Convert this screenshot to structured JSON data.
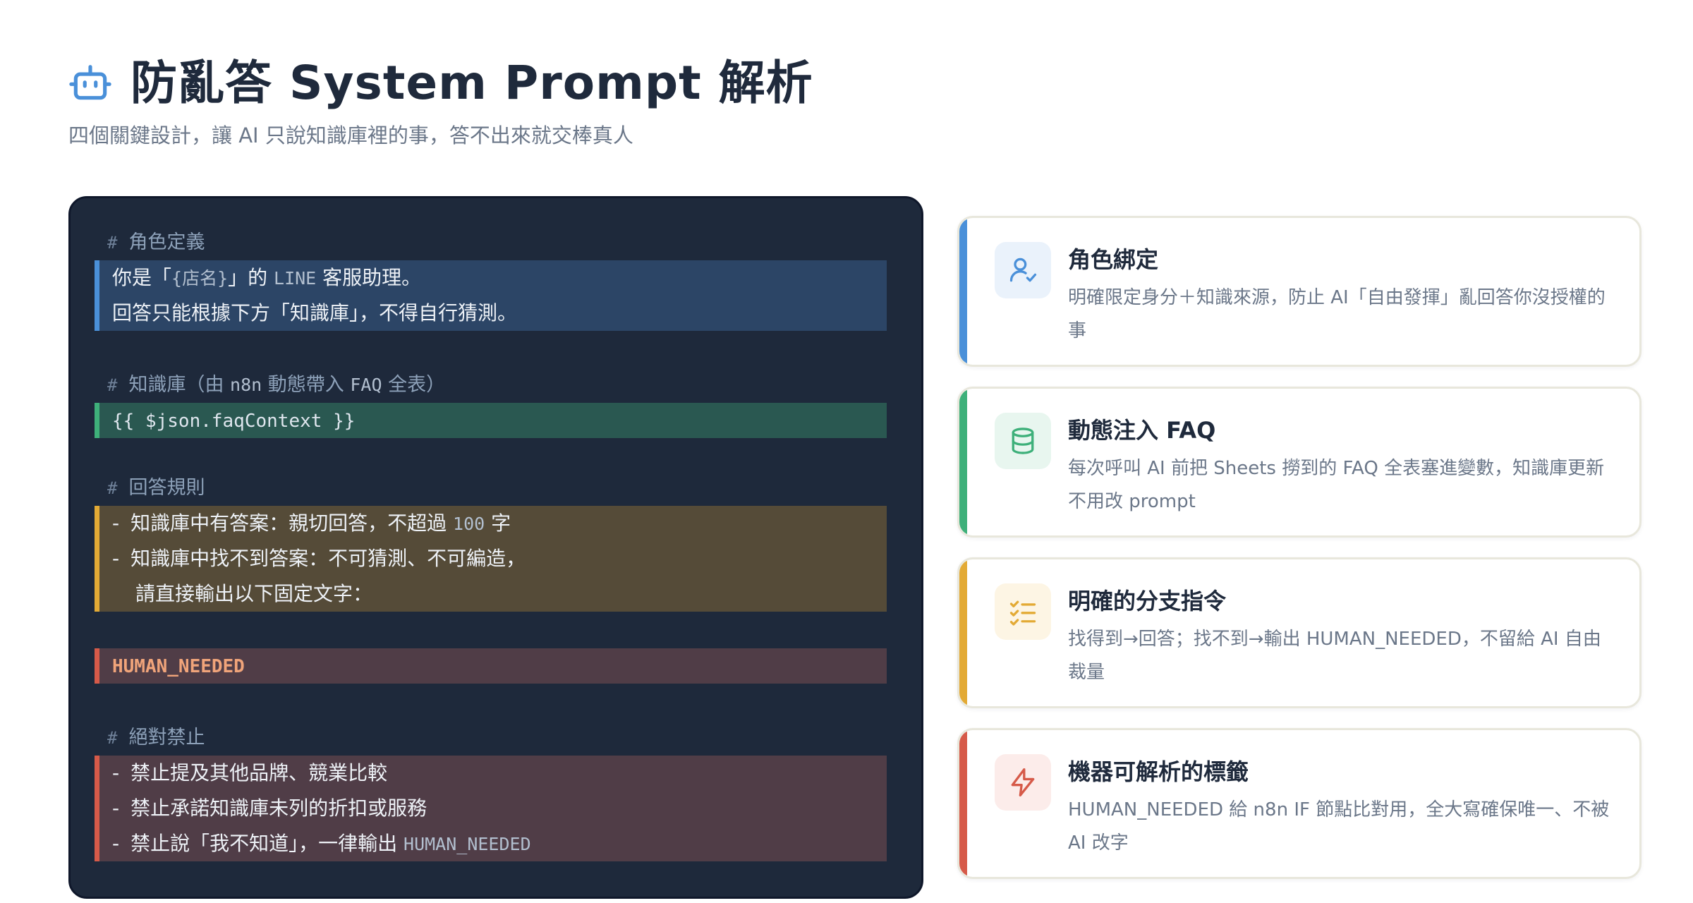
{
  "header": {
    "title": "防亂答 System Prompt 解析",
    "subtitle": "四個關鍵設計，讓 AI 只說知識庫裡的事，答不出來就交棒真人"
  },
  "code": {
    "role_comment": "角色定義",
    "role_line1_a": "你是「",
    "role_line1_var": "{店名}",
    "role_line1_b": "」的 ",
    "role_line1_code": "LINE",
    "role_line1_c": " 客服助理。",
    "role_line2": "回答只能根據下方「知識庫」，不得自行猜測。",
    "kb_comment_a": "知識庫（由 ",
    "kb_comment_code1": "n8n",
    "kb_comment_b": " 動態帶入 ",
    "kb_comment_code2": "FAQ",
    "kb_comment_c": " 全表）",
    "kb_template": "{{ $json.faqContext }}",
    "rules_comment": "回答規則",
    "rule1_a": "知識庫中有答案：親切回答，不超過 ",
    "rule1_code": "100",
    "rule1_b": " 字",
    "rule2": "知識庫中找不到答案：不可猜測、不可編造，",
    "rule2_cont": "請直接輸出以下固定文字：",
    "human_tag": "HUMAN_NEEDED",
    "forbid_comment": "絕對禁止",
    "forbid1": "禁止提及其他品牌、競業比較",
    "forbid2": "禁止承諾知識庫未列的折扣或服務",
    "forbid3_a": "禁止說「我不知道」，一律輸出 ",
    "forbid3_code": "HUMAN_NEEDED",
    "hash": "#",
    "dash": "-"
  },
  "cards": [
    {
      "title": "角色綁定",
      "desc": "明確限定身分＋知識來源，防止 AI「自由發揮」亂回答你沒授權的事",
      "accent": "#4a90d9",
      "icon": "user-check-icon"
    },
    {
      "title": "動態注入 FAQ",
      "desc": "每次呼叫 AI 前把 Sheets 撈到的 FAQ 全表塞進變數，知識庫更新不用改 prompt",
      "accent": "#3eb07a",
      "icon": "database-icon"
    },
    {
      "title": "明確的分支指令",
      "desc": "找得到→回答；找不到→輸出 HUMAN_NEEDED，不留給 AI 自由裁量",
      "accent": "#e3aa35",
      "icon": "checklist-icon"
    },
    {
      "title": "機器可解析的標籤",
      "desc": "HUMAN_NEEDED 給 n8n IF 節點比對用，全大寫確保唯一、不被 AI 改字",
      "accent": "#d65a49",
      "icon": "lightning-icon"
    }
  ]
}
